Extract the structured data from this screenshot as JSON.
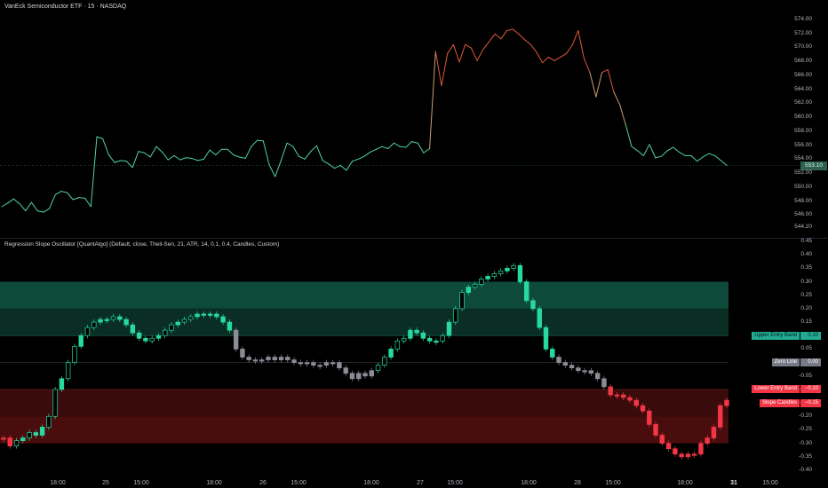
{
  "header": {
    "title": "VanEck Semiconductor ETF · 15 · NASDAQ"
  },
  "indicator": {
    "title": "Regression Slope Oscillator [QuantAlgo] (Default, close, Theil-Sen, 21, ATR, 14, 0.1, 0.4, Candles, Custom)"
  },
  "price_axis": {
    "ticks": [
      "574.00",
      "572.00",
      "570.00",
      "568.00",
      "566.00",
      "564.00",
      "562.00",
      "560.00",
      "558.00",
      "556.00",
      "554.00",
      "552.00",
      "550.00",
      "548.00",
      "546.00",
      "544.20"
    ],
    "current_price": "553.10"
  },
  "osc_axis": {
    "ticks": [
      "0.45",
      "0.40",
      "0.35",
      "0.30",
      "0.25",
      "0.20",
      "0.15",
      "0.10",
      "0.05",
      "0.00",
      "-0.05",
      "-0.10",
      "-0.15",
      "-0.20",
      "-0.25",
      "-0.30",
      "-0.35",
      "-0.40"
    ]
  },
  "band_labels": [
    {
      "label": "Upper Entry Band",
      "value": "0.10",
      "bg": "#22ab94"
    },
    {
      "label": "Zero Line",
      "value": "0.00",
      "bg": "#787b86"
    },
    {
      "label": "Lower Entry Band",
      "value": "−0.10",
      "bg": "#f23645"
    },
    {
      "label": "Slope Candles",
      "value": "−0.15",
      "bg": "#f23645"
    }
  ],
  "time_axis": {
    "ticks": [
      {
        "label": "18:00",
        "bold": false
      },
      {
        "label": "25",
        "bold": false
      },
      {
        "label": "15:00",
        "bold": false
      },
      {
        "label": "18:00",
        "bold": false
      },
      {
        "label": "26",
        "bold": false
      },
      {
        "label": "15:00",
        "bold": false
      },
      {
        "label": "18:00",
        "bold": false
      },
      {
        "label": "27",
        "bold": false
      },
      {
        "label": "15:00",
        "bold": false
      },
      {
        "label": "18:00",
        "bold": false
      },
      {
        "label": "28",
        "bold": false
      },
      {
        "label": "15:00",
        "bold": false
      },
      {
        "label": "18:00",
        "bold": false
      },
      {
        "label": "31",
        "bold": true
      },
      {
        "label": "15:00",
        "bold": false
      }
    ]
  },
  "colors": {
    "up": "#26d9a0",
    "down": "#f23645",
    "neutral": "#8a8d96",
    "upper_band_fill": "#0b3b2e",
    "lower_band_fill": "#3b0a0a"
  },
  "chart_data": [
    {
      "type": "line",
      "title": "VanEck Semiconductor ETF · 15 · NASDAQ",
      "ylim": [
        543.5,
        575
      ],
      "y": [
        547.2,
        547.7,
        548.3,
        547.6,
        546.6,
        547.8,
        546.6,
        546.4,
        546.9,
        548.9,
        549.4,
        549.2,
        548.2,
        548.5,
        548.4,
        547.2,
        557.2,
        556.9,
        554.6,
        553.5,
        553.8,
        553.7,
        552.8,
        555.1,
        554.9,
        554.3,
        555.8,
        555.0,
        553.9,
        554.5,
        553.9,
        554.2,
        554.1,
        553.8,
        554.0,
        555.3,
        554.6,
        555.4,
        555.4,
        554.6,
        554.3,
        554.1,
        555.8,
        556.7,
        556.6,
        553.2,
        551.5,
        553.8,
        556.3,
        555.8,
        554.4,
        554.0,
        555.1,
        555.9,
        553.8,
        553.3,
        552.7,
        553.1,
        552.4,
        553.7,
        554.0,
        554.4,
        555.0,
        555.4,
        555.8,
        555.5,
        556.3,
        555.8,
        555.7,
        556.5,
        556.3,
        554.9,
        555.5,
        569.4,
        564.5,
        569.1,
        570.4,
        567.9,
        570.4,
        569.9,
        568.1,
        569.7,
        570.8,
        571.9,
        571.2,
        572.4,
        572.6,
        571.9,
        571.1,
        570.4,
        569.3,
        567.8,
        568.6,
        568.1,
        568.6,
        569.1,
        570.3,
        572.4,
        568.4,
        566.3,
        562.9,
        566.4,
        566.8,
        563.6,
        561.8,
        558.9,
        555.8,
        555.2,
        554.5,
        556.1,
        554.2,
        554.4,
        555.2,
        555.7,
        555.0,
        554.5,
        554.5,
        553.7,
        554.3,
        554.8,
        554.5,
        553.8,
        553.1
      ]
    },
    {
      "type": "bar",
      "title": "Regression Slope Oscillator [QuantAlgo] (Default, close, Theil-Sen, 21, ATR, 14, 0.1, 0.4, Candles, Custom)",
      "ylim": [
        -0.4,
        0.45
      ],
      "bands": {
        "upper_entry": 0.1,
        "zero": 0.0,
        "lower_entry": -0.1,
        "upper_zone": [
          0.1,
          0.3
        ],
        "lower_zone": [
          -0.3,
          -0.1
        ]
      },
      "values": [
        -0.28,
        -0.31,
        -0.29,
        -0.28,
        -0.26,
        -0.27,
        -0.24,
        -0.2,
        -0.1,
        -0.06,
        0.0,
        0.06,
        0.1,
        0.13,
        0.15,
        0.16,
        0.16,
        0.17,
        0.16,
        0.14,
        0.11,
        0.09,
        0.08,
        0.09,
        0.1,
        0.12,
        0.14,
        0.15,
        0.16,
        0.17,
        0.18,
        0.18,
        0.18,
        0.17,
        0.15,
        0.12,
        0.05,
        0.02,
        0.01,
        0.01,
        0.01,
        0.02,
        0.01,
        0.02,
        0.01,
        0.0,
        0.0,
        0.0,
        -0.01,
        -0.01,
        0.0,
        0.0,
        -0.02,
        -0.04,
        -0.06,
        -0.04,
        -0.05,
        -0.03,
        -0.01,
        0.02,
        0.05,
        0.08,
        0.09,
        0.12,
        0.11,
        0.09,
        0.08,
        0.08,
        0.1,
        0.15,
        0.2,
        0.26,
        0.28,
        0.29,
        0.31,
        0.32,
        0.33,
        0.34,
        0.35,
        0.36,
        0.3,
        0.23,
        0.2,
        0.13,
        0.05,
        0.02,
        0.0,
        -0.01,
        -0.02,
        -0.03,
        -0.03,
        -0.04,
        -0.06,
        -0.09,
        -0.12,
        -0.12,
        -0.13,
        -0.14,
        -0.16,
        -0.18,
        -0.23,
        -0.27,
        -0.3,
        -0.32,
        -0.34,
        -0.35,
        -0.34,
        -0.34,
        -0.3,
        -0.28,
        -0.24,
        -0.16,
        -0.14
      ],
      "colors": [
        "down",
        "down",
        "up",
        "up",
        "up",
        "up",
        "up",
        "up",
        "up",
        "up",
        "up",
        "up",
        "up",
        "up",
        "up",
        "up",
        "up",
        "up",
        "up",
        "up",
        "up",
        "up",
        "up",
        "up",
        "up",
        "up",
        "up",
        "up",
        "up",
        "up",
        "up",
        "up",
        "up",
        "up",
        "up",
        "up",
        "neutral",
        "neutral",
        "neutral",
        "neutral",
        "neutral",
        "neutral",
        "neutral",
        "neutral",
        "neutral",
        "neutral",
        "neutral",
        "neutral",
        "neutral",
        "neutral",
        "neutral",
        "neutral",
        "neutral",
        "neutral",
        "neutral",
        "neutral",
        "neutral",
        "neutral",
        "up",
        "up",
        "up",
        "up",
        "up",
        "up",
        "up",
        "up",
        "up",
        "up",
        "up",
        "up",
        "up",
        "up",
        "up",
        "up",
        "up",
        "up",
        "up",
        "up",
        "up",
        "up",
        "up",
        "up",
        "up",
        "up",
        "up",
        "up",
        "neutral",
        "neutral",
        "neutral",
        "neutral",
        "neutral",
        "neutral",
        "neutral",
        "neutral",
        "down",
        "down",
        "down",
        "down",
        "down",
        "down",
        "down",
        "down",
        "down",
        "down",
        "down",
        "down",
        "down",
        "down",
        "down",
        "down",
        "down",
        "down",
        "down",
        "down",
        "down"
      ]
    }
  ]
}
